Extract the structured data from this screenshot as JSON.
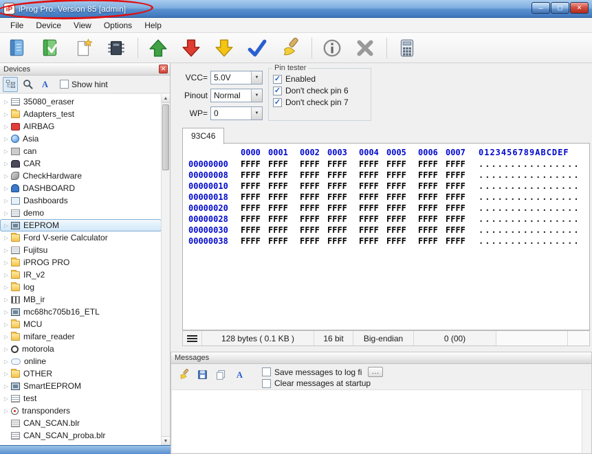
{
  "colors": {
    "accent_blue": "#3f76bd",
    "hex_blue": "#0008cc",
    "selection": "#cfe6f9",
    "annotation_red": "#e01010"
  },
  "window": {
    "title": "iProg Pro. Version 85 [admin]"
  },
  "menu": {
    "items": [
      "File",
      "Device",
      "View",
      "Options",
      "Help"
    ]
  },
  "toolbar": {
    "buttons": [
      {
        "name": "open",
        "icon": "book-blue"
      },
      {
        "name": "save",
        "icon": "book-green"
      },
      {
        "name": "new",
        "icon": "page-new"
      },
      {
        "name": "device",
        "icon": "chip"
      },
      {
        "name": "sep"
      },
      {
        "name": "read",
        "icon": "arrow-up-green"
      },
      {
        "name": "write",
        "icon": "arrow-down-red"
      },
      {
        "name": "load",
        "icon": "arrow-down-yellow"
      },
      {
        "name": "verify",
        "icon": "check-blue"
      },
      {
        "name": "erase",
        "icon": "brush"
      },
      {
        "name": "sep"
      },
      {
        "name": "info",
        "icon": "info"
      },
      {
        "name": "cancel",
        "icon": "cancel"
      },
      {
        "name": "sep"
      },
      {
        "name": "calculator",
        "icon": "calculator"
      }
    ]
  },
  "devices": {
    "title": "Devices",
    "show_hint_label": "Show hint",
    "show_hint_checked": false,
    "toolbar": [
      {
        "name": "tree-view",
        "icon": "treeview",
        "pressed": true
      },
      {
        "name": "search",
        "icon": "search",
        "pressed": false
      },
      {
        "name": "font",
        "icon": "letter-a",
        "pressed": false
      }
    ],
    "items": [
      {
        "label": "35080_eraser",
        "icon": "page"
      },
      {
        "label": "Adapters_test",
        "icon": "folder"
      },
      {
        "label": "AIRBAG",
        "icon": "red"
      },
      {
        "label": "Asia",
        "icon": "globe"
      },
      {
        "label": "can",
        "icon": "gray"
      },
      {
        "label": "CAR",
        "icon": "car"
      },
      {
        "label": "CheckHardware",
        "icon": "wrench"
      },
      {
        "label": "DASHBOARD",
        "icon": "gauge"
      },
      {
        "label": "Dashboards",
        "icon": "panel"
      },
      {
        "label": "demo",
        "icon": "page"
      },
      {
        "label": "EEPROM",
        "icon": "chip",
        "selected": true
      },
      {
        "label": "Ford V-serie Calculator",
        "icon": "folder"
      },
      {
        "label": "Fujitsu",
        "icon": "page"
      },
      {
        "label": "iPROG PRO",
        "icon": "folder"
      },
      {
        "label": "IR_v2",
        "icon": "folder"
      },
      {
        "label": "log",
        "icon": "folder"
      },
      {
        "label": "MB_ir",
        "icon": "antenna"
      },
      {
        "label": "mc68hc705b16_ETL",
        "icon": "chip"
      },
      {
        "label": "MCU",
        "icon": "folder"
      },
      {
        "label": "mifare_reader",
        "icon": "folder"
      },
      {
        "label": "motorola",
        "icon": "circle"
      },
      {
        "label": "online",
        "icon": "cloud"
      },
      {
        "label": "OTHER",
        "icon": "folder"
      },
      {
        "label": "SmartEEPROM",
        "icon": "chip"
      },
      {
        "label": "test",
        "icon": "page"
      },
      {
        "label": "transponders",
        "icon": "signal"
      },
      {
        "label": "CAN_SCAN.blr",
        "icon": "file",
        "arrow": false
      },
      {
        "label": "CAN_SCAN_proba.blr",
        "icon": "file",
        "arrow": false
      }
    ]
  },
  "settings": {
    "vcc_label": "VCC=",
    "vcc_value": "5.0V",
    "pinout_label": "Pinout",
    "pinout_value": "Normal",
    "wp_label": "WP=",
    "wp_value": "0",
    "pin_tester": {
      "title": "Pin tester",
      "options": [
        {
          "label": "Enabled",
          "checked": true
        },
        {
          "label": "Don't check pin 6",
          "checked": true
        },
        {
          "label": "Don't check pin 7",
          "checked": true
        }
      ]
    }
  },
  "editor": {
    "tab": "93C46",
    "col_headers": [
      "0000",
      "0001",
      "0002",
      "0003",
      "0004",
      "0005",
      "0006",
      "0007"
    ],
    "ascii_header": "0123456789ABCDEF",
    "rows": [
      {
        "addr": "00000000",
        "values": [
          "FFFF",
          "FFFF",
          "FFFF",
          "FFFF",
          "FFFF",
          "FFFF",
          "FFFF",
          "FFFF"
        ],
        "ascii": "................"
      },
      {
        "addr": "00000008",
        "values": [
          "FFFF",
          "FFFF",
          "FFFF",
          "FFFF",
          "FFFF",
          "FFFF",
          "FFFF",
          "FFFF"
        ],
        "ascii": "................"
      },
      {
        "addr": "00000010",
        "values": [
          "FFFF",
          "FFFF",
          "FFFF",
          "FFFF",
          "FFFF",
          "FFFF",
          "FFFF",
          "FFFF"
        ],
        "ascii": "................"
      },
      {
        "addr": "00000018",
        "values": [
          "FFFF",
          "FFFF",
          "FFFF",
          "FFFF",
          "FFFF",
          "FFFF",
          "FFFF",
          "FFFF"
        ],
        "ascii": "................"
      },
      {
        "addr": "00000020",
        "values": [
          "FFFF",
          "FFFF",
          "FFFF",
          "FFFF",
          "FFFF",
          "FFFF",
          "FFFF",
          "FFFF"
        ],
        "ascii": "................"
      },
      {
        "addr": "00000028",
        "values": [
          "FFFF",
          "FFFF",
          "FFFF",
          "FFFF",
          "FFFF",
          "FFFF",
          "FFFF",
          "FFFF"
        ],
        "ascii": "................"
      },
      {
        "addr": "00000030",
        "values": [
          "FFFF",
          "FFFF",
          "FFFF",
          "FFFF",
          "FFFF",
          "FFFF",
          "FFFF",
          "FFFF"
        ],
        "ascii": "................"
      },
      {
        "addr": "00000038",
        "values": [
          "FFFF",
          "FFFF",
          "FFFF",
          "FFFF",
          "FFFF",
          "FFFF",
          "FFFF",
          "FFFF"
        ],
        "ascii": "................"
      }
    ],
    "status": {
      "size": "128 bytes ( 0.1 KB )",
      "bits": "16 bit",
      "endian": "Big-endian",
      "value": "0 (00)"
    }
  },
  "messages": {
    "title": "Messages",
    "toolbar": [
      {
        "name": "clear",
        "icon": "brush"
      },
      {
        "name": "save-log",
        "icon": "floppy"
      },
      {
        "name": "copy",
        "icon": "pages"
      },
      {
        "name": "font",
        "icon": "letter-a"
      }
    ],
    "save_to_log_label": "Save messages to log fi",
    "save_to_log_checked": false,
    "browse_label": "...",
    "clear_label": "Clear messages at startup",
    "clear_checked": false
  }
}
